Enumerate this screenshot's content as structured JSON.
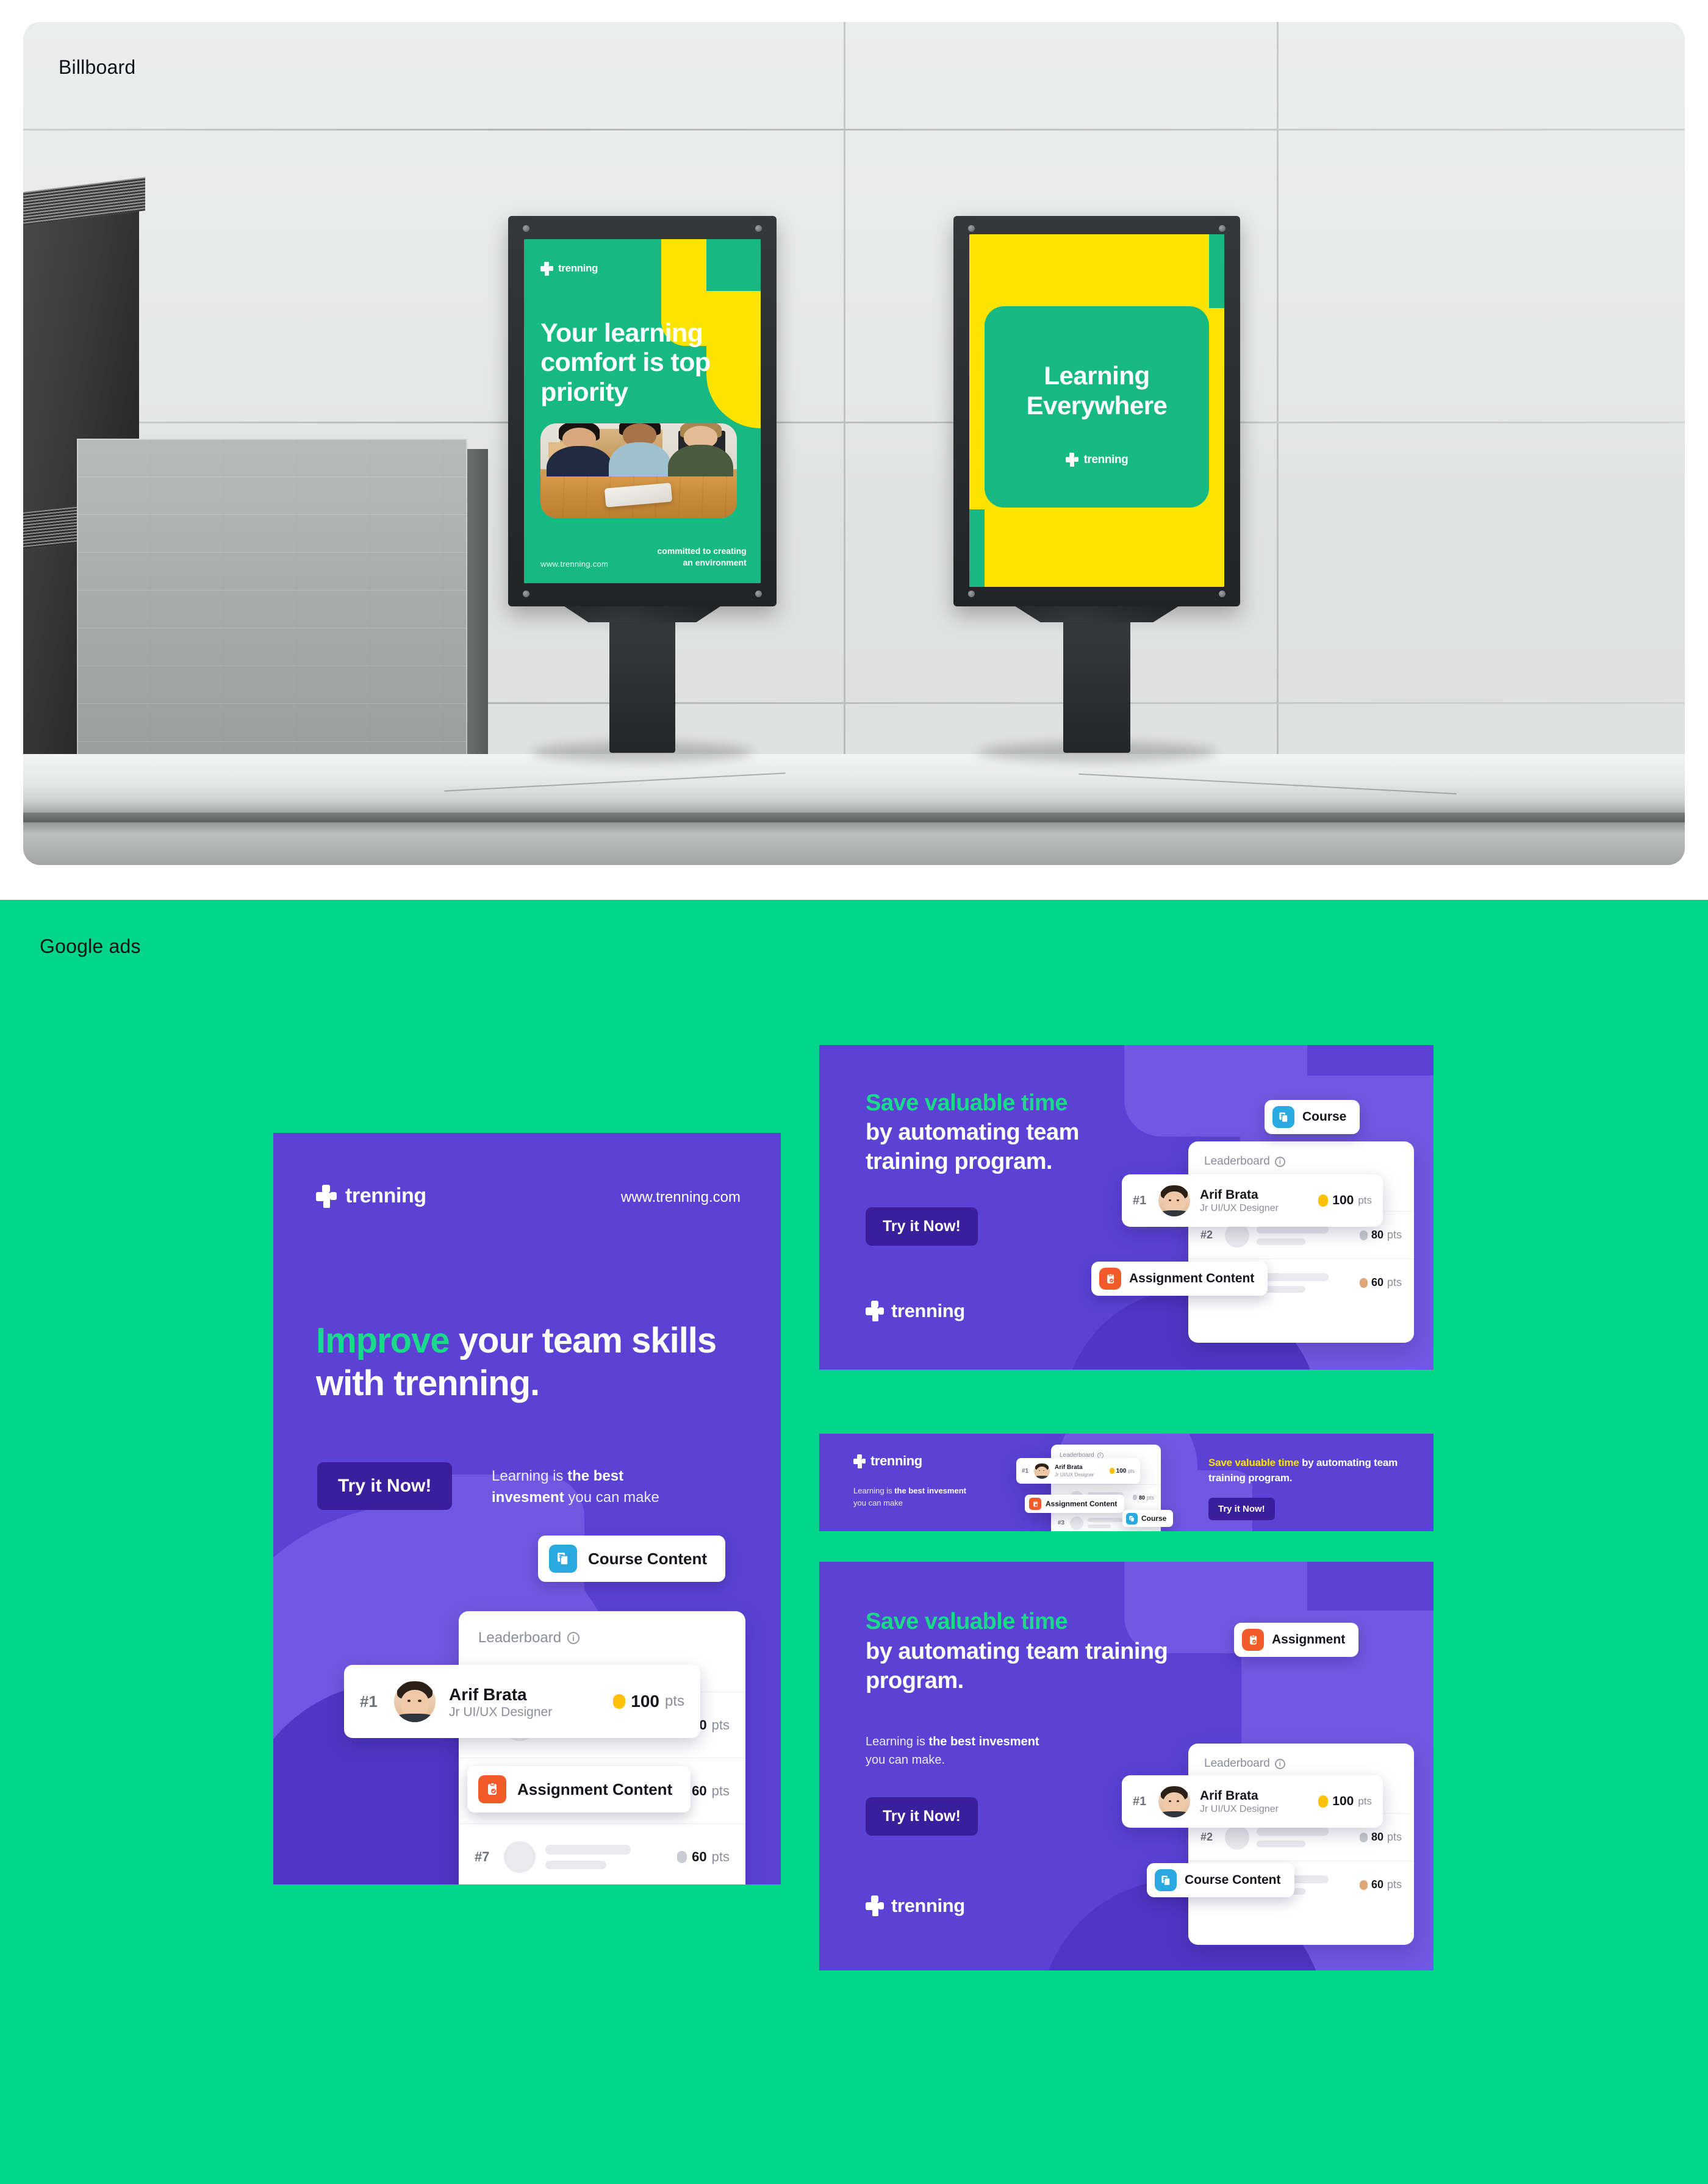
{
  "sections": {
    "billboard_label": "Billboard",
    "googleads_label": "Google ads"
  },
  "brand": {
    "name": "trenning",
    "url": "www.trenning.com",
    "colors": {
      "green": "#00D68A",
      "teal": "#15B981",
      "yellow": "#FCE300",
      "purple": "#5B42D4",
      "purple_light": "#7158E2",
      "purple_dark": "#3A1E9B",
      "accent_green": "#19D98A",
      "blue_icon": "#29A9E0",
      "orange_icon": "#F15B2A",
      "gold": "#FFC107"
    }
  },
  "billboard": {
    "poster_left": {
      "logo": "trenning",
      "headline": "Your learning comfort is top priority",
      "url": "www.trenning.com",
      "tagline_line1": "committed to creating",
      "tagline_line2": "an environment"
    },
    "poster_right": {
      "headline_line1": "Learning",
      "headline_line2": "Everywhere",
      "logo": "trenning"
    }
  },
  "leaderboard": {
    "title": "Leaderboard",
    "info_icon": "info-icon",
    "top_entry": {
      "rank": "#1",
      "name": "Arif Brata",
      "role": "Jr UI/UX Designer",
      "points": "100",
      "points_unit": "pts",
      "gem": "gold"
    },
    "rows": [
      {
        "rank": "#2",
        "points": "80",
        "points_unit": "pts",
        "gem": "silver"
      },
      {
        "rank": "#3",
        "points": "60",
        "points_unit": "pts",
        "gem": "bronze"
      },
      {
        "rank": "#7",
        "points": "60",
        "points_unit": "pts",
        "gem": "silver"
      }
    ]
  },
  "chips": {
    "course_content": "Course Content",
    "course": "Course",
    "assignment_content": "Assignment Content",
    "assignment": "Assignment"
  },
  "ads": {
    "vertical": {
      "logo": "trenning",
      "url": "www.trenning.com",
      "headline_accent": "Improve",
      "headline_rest": " your team skills with trenning.",
      "cta": "Try it Now!",
      "sub_a": "Learning is ",
      "sub_b": "the best invesment",
      "sub_c": " you can make"
    },
    "square": {
      "headline_accent": "Save valuable time",
      "headline_rest": "by automating team training program.",
      "cta": "Try it Now!",
      "logo": "trenning"
    },
    "banner": {
      "logo": "trenning",
      "sub_a": "Learning is ",
      "sub_b": "the best invesment",
      "sub_c": "you can make",
      "headline_accent": "Save valuable time",
      "headline_rest": " by automating team training program.",
      "cta": "Try it Now!"
    },
    "wide": {
      "headline_accent": "Save valuable time",
      "headline_rest": "by automating team training program.",
      "sub_a": "Learning is ",
      "sub_b": "the best invesment",
      "sub_c": "you can make.",
      "cta": "Try it Now!",
      "logo": "trenning"
    }
  }
}
